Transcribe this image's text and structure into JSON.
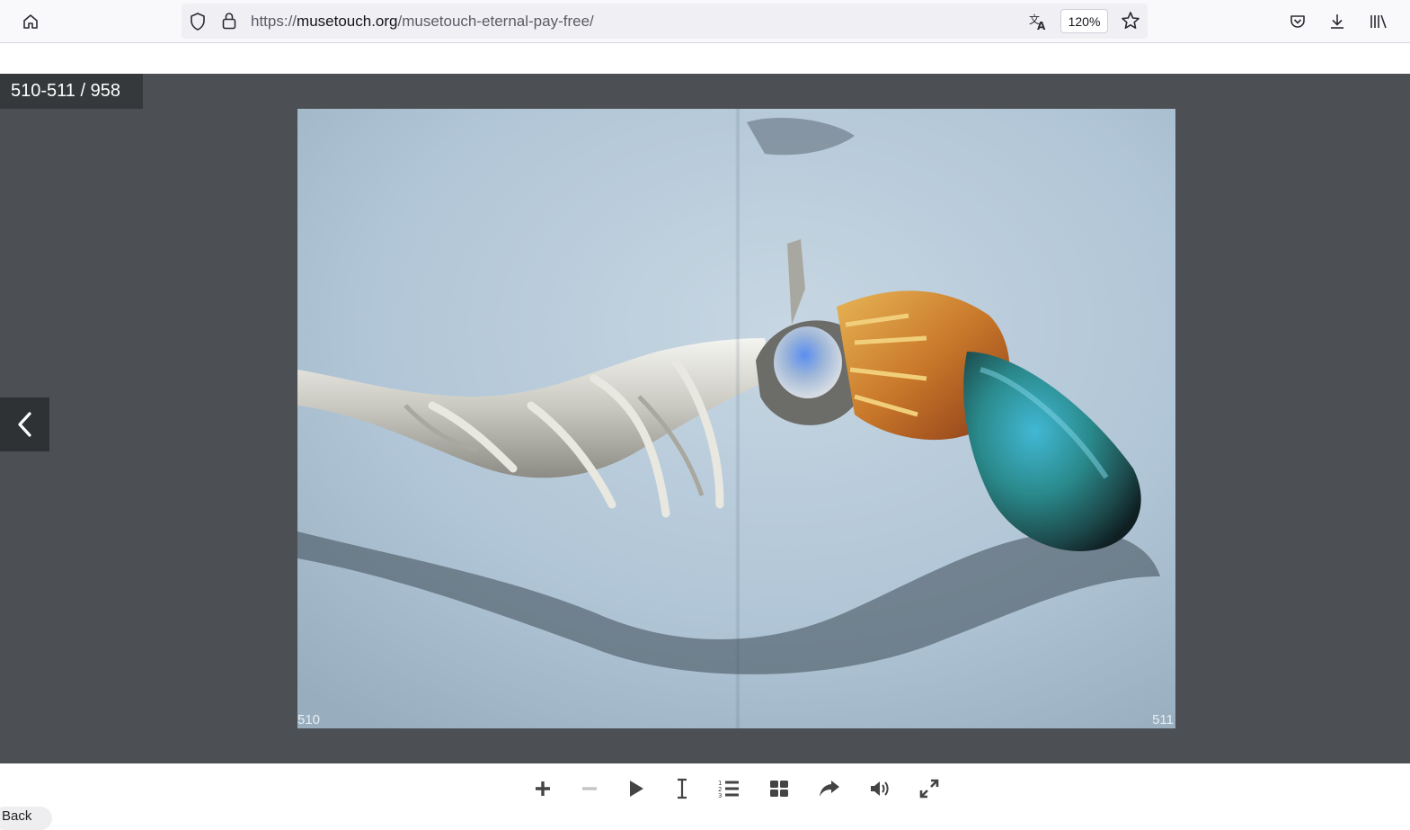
{
  "browser": {
    "url_scheme": "https://",
    "url_host": "musetouch.org",
    "url_path": "/musetouch-eternal-pay-free/",
    "zoom_level": "120%",
    "icons": [
      "home-icon",
      "shield-icon",
      "lock-icon",
      "translate-icon",
      "star-icon",
      "pocket-icon",
      "download-icon",
      "library-icon"
    ]
  },
  "viewer": {
    "page_counter": "510-511 / 958",
    "left_page_number": "510",
    "right_page_number": "511",
    "background_color": "#4c5054",
    "image_description_icon": "jewelry-photo"
  },
  "controls": {
    "buttons": [
      "zoom-in",
      "zoom-out",
      "play",
      "text-select",
      "table-of-contents",
      "thumbnails",
      "share",
      "sound",
      "fullscreen"
    ]
  },
  "bottom_chip": {
    "label": "Back"
  }
}
